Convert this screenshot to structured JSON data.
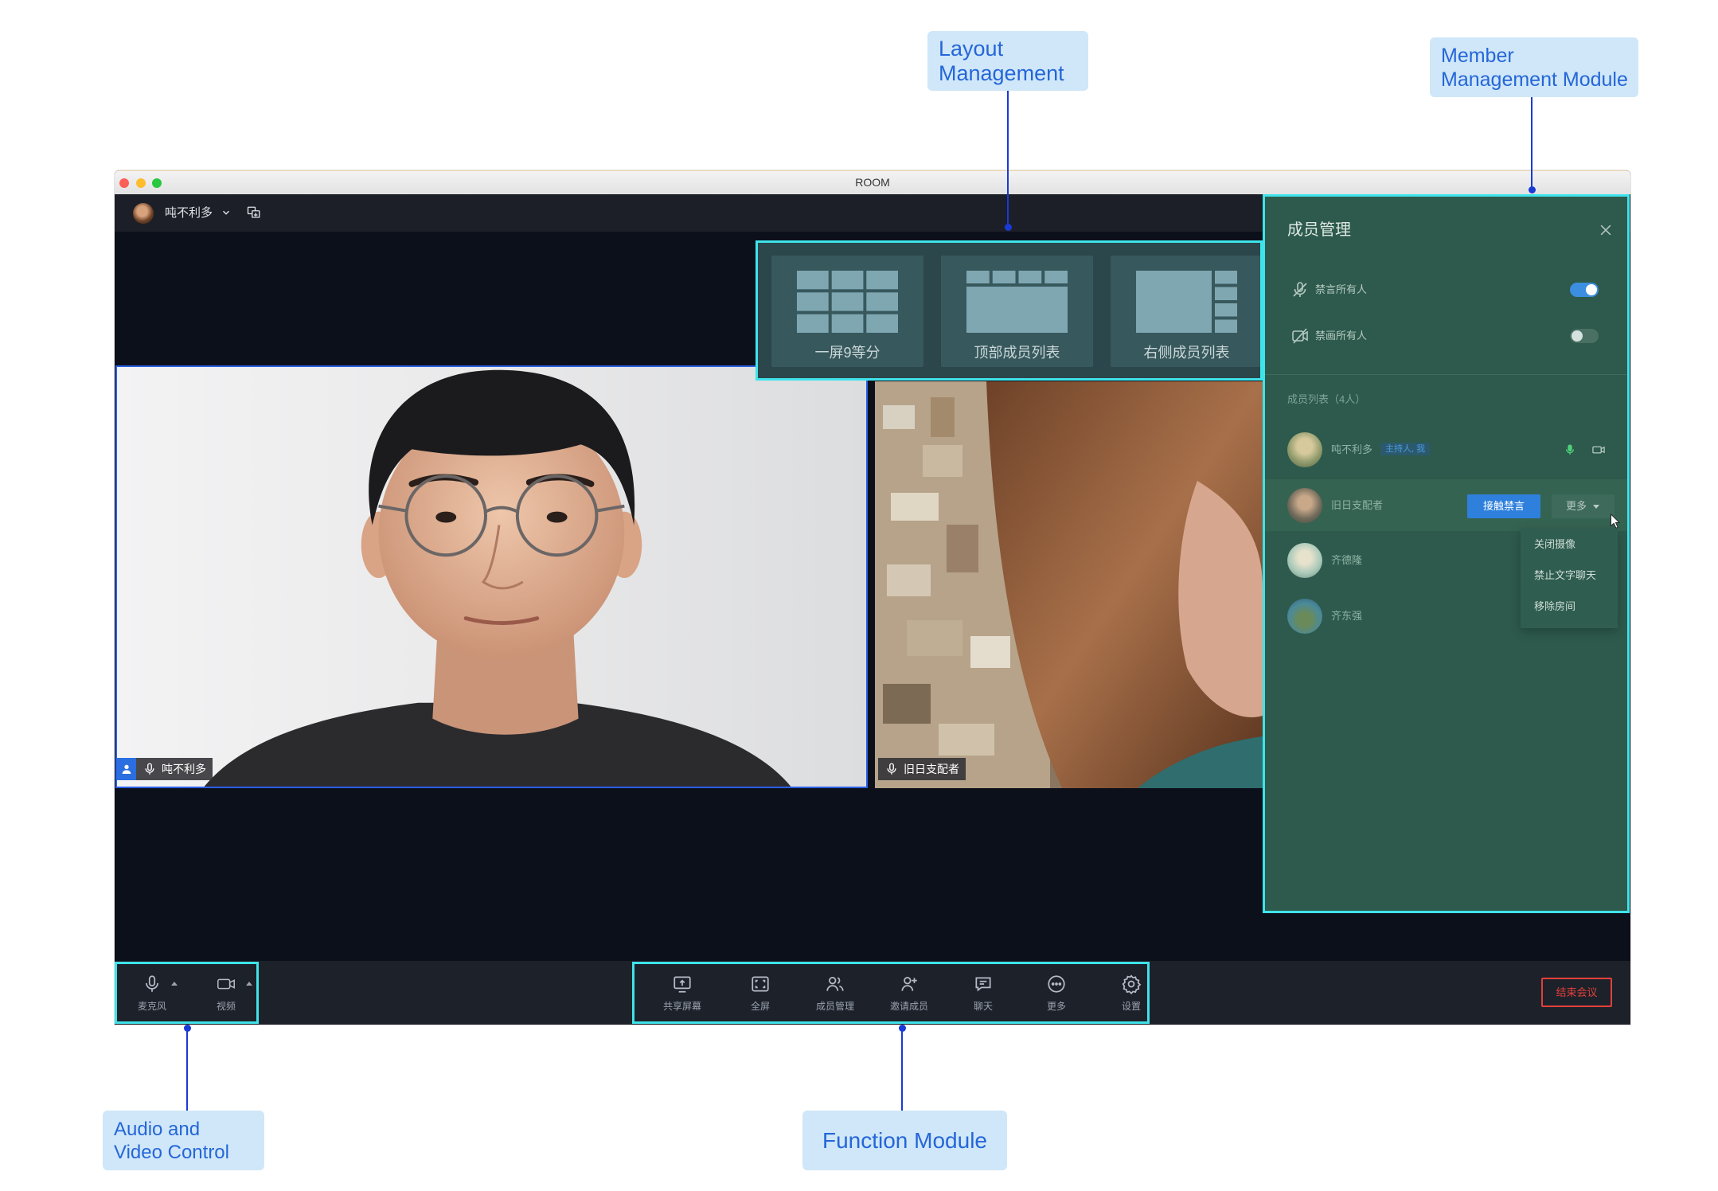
{
  "callouts": {
    "layout_management": {
      "lines": [
        "Layout",
        "Management"
      ]
    },
    "member_management": {
      "lines": [
        "Member",
        "Management Module"
      ]
    },
    "audio_video_control": {
      "lines": [
        "Audio and",
        "Video Control"
      ]
    },
    "function_module": {
      "lines": [
        "Function Module"
      ]
    }
  },
  "window": {
    "title": "ROOM"
  },
  "top_bar": {
    "user_name": "吨不利多",
    "icons": {
      "avatar": "user-avatar",
      "menu": "chevron-down-icon",
      "translate": "translate-icon"
    }
  },
  "layout_panel": {
    "options": [
      {
        "label": "一屏9等分",
        "icon": "grid-nine-icon"
      },
      {
        "label": "顶部成员列表",
        "icon": "layout-top-list-icon"
      },
      {
        "label": "右侧成员列表",
        "icon": "layout-right-list-icon"
      }
    ]
  },
  "videos": [
    {
      "name": "吨不利多",
      "icons": [
        "user-icon",
        "mic-icon"
      ]
    },
    {
      "name": "旧日支配者",
      "icons": [
        "mic-icon"
      ]
    }
  ],
  "member_panel": {
    "title": "成员管理",
    "close_icon": "close-icon",
    "controls": [
      {
        "label": "禁言所有人",
        "icon": "mic-off-icon",
        "enabled": true
      },
      {
        "label": "禁画所有人",
        "icon": "video-off-icon",
        "enabled": false
      }
    ],
    "list_title": "成员列表（4人）",
    "members": [
      {
        "name": "吨不利多",
        "tag": "主持人, 我",
        "icons": [
          "mic-icon",
          "camera-icon"
        ]
      },
      {
        "name": "旧日支配者",
        "action_label": "接触禁言",
        "more_label": "更多",
        "icons": [
          "caret-down-icon"
        ]
      },
      {
        "name": "齐德隆"
      },
      {
        "name": "齐东强"
      }
    ],
    "more_menu": [
      {
        "label": "关闭摄像"
      },
      {
        "label": "禁止文字聊天"
      },
      {
        "label": "移除房间"
      }
    ]
  },
  "bottom_bar": {
    "audio_video": [
      {
        "label": "麦克风",
        "icon": "mic-icon"
      },
      {
        "label": "视频",
        "icon": "video-icon"
      }
    ],
    "functions": [
      {
        "label": "共享屏幕",
        "icon": "share-screen-icon"
      },
      {
        "label": "全屏",
        "icon": "fullscreen-icon"
      },
      {
        "label": "成员管理",
        "icon": "members-icon"
      },
      {
        "label": "邀请成员",
        "icon": "invite-member-icon"
      },
      {
        "label": "聊天",
        "icon": "chat-icon"
      },
      {
        "label": "更多",
        "icon": "more-icon"
      },
      {
        "label": "设置",
        "icon": "settings-icon"
      }
    ],
    "end_meeting_label": "结束会议"
  },
  "colors": {
    "accent": "#3fe3ea",
    "callout_bg": "#cfe7f8",
    "callout_text": "#2566d8",
    "connector": "#1a3ad6",
    "danger": "#e2403a",
    "primary": "#2f80dc",
    "toggle_on": "#3b8ee0",
    "panel_bg": "#2d5a4c"
  }
}
